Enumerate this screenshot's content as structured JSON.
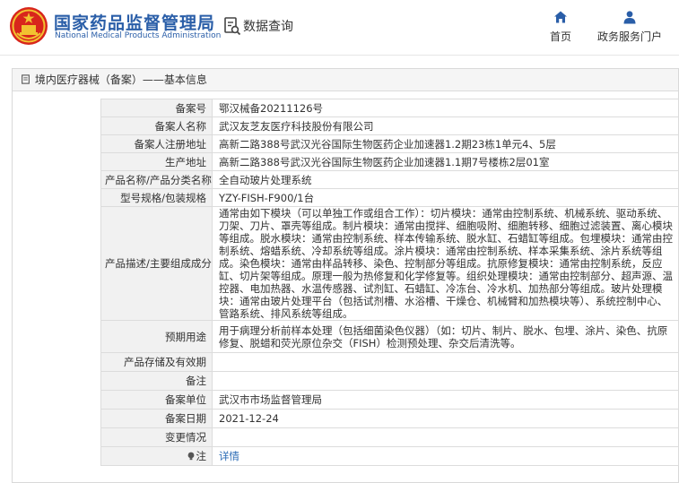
{
  "header": {
    "org_name_cn": "国家药品监督管理局",
    "org_name_en": "National Medical Products Administration",
    "query_label": "数据查询",
    "nav": {
      "home_label": "首页",
      "service_label": "政务服务门户"
    }
  },
  "panel": {
    "title": "境内医疗器械（备案）——基本信息"
  },
  "record": {
    "rows": [
      {
        "label": "备案号",
        "value": "鄂汉械备20211126号"
      },
      {
        "label": "备案人名称",
        "value": "武汉友芝友医疗科技股份有限公司"
      },
      {
        "label": "备案人注册地址",
        "value": "高新二路388号武汉光谷国际生物医药企业加速器1.2期23栋1单元4、5层"
      },
      {
        "label": "生产地址",
        "value": "高新二路388号武汉光谷国际生物医药企业加速器1.1期7号楼栋2层01室"
      },
      {
        "label": "产品名称/产品分类名称",
        "value": "全自动玻片处理系统"
      },
      {
        "label": "型号规格/包装规格",
        "value": "YZY-FISH-F900/1台"
      },
      {
        "label": "产品描述/主要组成成分",
        "value": "通常由如下模块（可以单独工作或组合工作）：切片模块：通常由控制系统、机械系统、驱动系统、刀架、刀片、罩壳等组成。制片模块：通常由搅拌、细胞吸附、细胞转移、细胞过滤装置、离心模块等组成。脱水模块：通常由控制系统、样本传输系统、脱水缸、石蜡缸等组成。包埋模块：通常由控制系统、熔蜡系统、冷却系统等组成。涂片模块：通常由控制系统、样本采集系统、涂片系统等组成。染色模块：通常由样品转移、染色、控制部分等组成。抗原修复模块：通常由控制系统，反应缸、切片架等组成。原理一般为热修复和化学修复等。组织处理模块：通常由控制部分、超声源、温控器、电加热器、水温传感器、试剂缸、石蜡缸、冷冻台、冷水机、加热部分等组成。玻片处理模块：通常由玻片处理平台（包括试剂槽、水浴槽、干燥仓、机械臂和加热模块等）、系统控制中心、管路系统、排风系统等组成。"
      },
      {
        "label": "预期用途",
        "value": "用于病理分析前样本处理（包括细菌染色仪器）（如：切片、制片、脱水、包埋、涂片、染色、抗原修复、脱蜡和荧光原位杂交（FISH）检测预处理、杂交后清洗等。"
      },
      {
        "label": "产品存储及有效期",
        "value": ""
      },
      {
        "label": "备注",
        "value": ""
      },
      {
        "label": "备案单位",
        "value": "武汉市市场监督管理局"
      },
      {
        "label": "备案日期",
        "value": "2021-12-24"
      },
      {
        "label": "变更情况",
        "value": ""
      }
    ],
    "note": {
      "label": "注",
      "link_text": "详情"
    }
  },
  "colors": {
    "brand_blue": "#2a5ea8",
    "emblem_red": "#d8261c",
    "emblem_gold": "#f2c230",
    "link_blue": "#2a6bb5",
    "label_bg": "#f1f1f1",
    "border": "#dcdcdc"
  },
  "icons": {
    "logo": "national-emblem-icon",
    "query": "document-search-icon",
    "home": "home-icon",
    "service": "user-icon",
    "panel": "document-icon",
    "note": "info-bulb-icon"
  }
}
